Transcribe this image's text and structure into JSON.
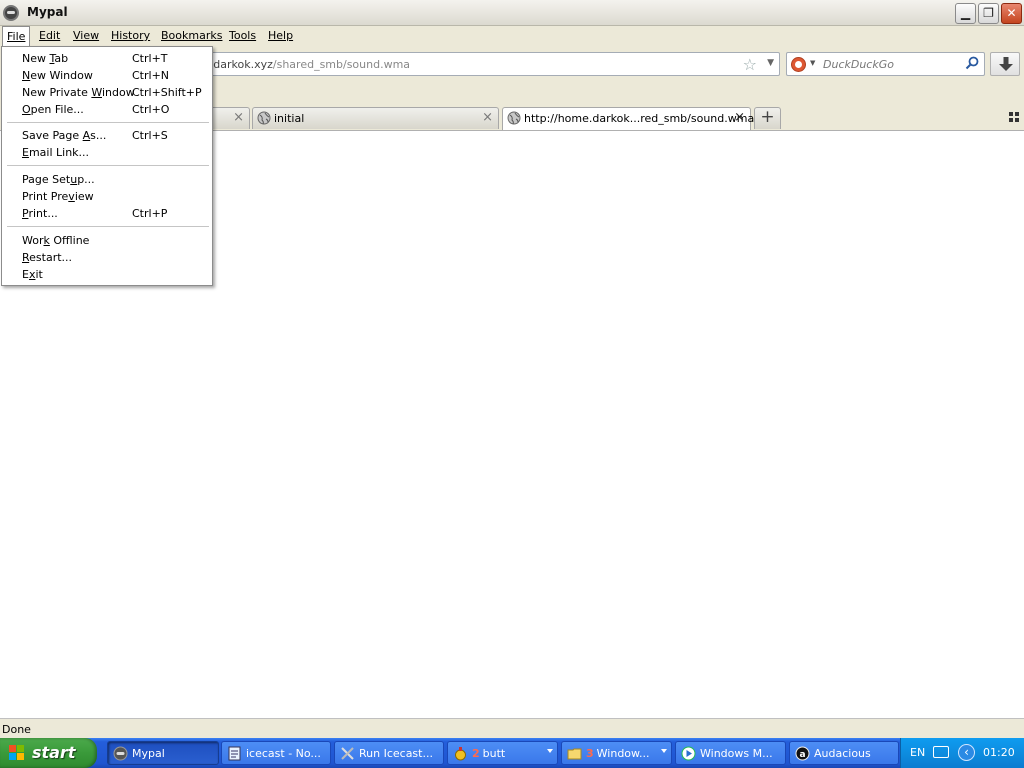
{
  "window": {
    "title": "Mypal"
  },
  "menubar": {
    "items": [
      "File",
      "Edit",
      "View",
      "History",
      "Bookmarks",
      "Tools",
      "Help"
    ]
  },
  "navbar": {
    "url_host": "e.darkok.xyz",
    "url_path": "/shared_smb/sound.wma",
    "search_placeholder": "DuckDuckGo"
  },
  "tabs": [
    {
      "label": ""
    },
    {
      "label": "initial"
    },
    {
      "label": "http://home.darkok...red_smb/sound.wma"
    }
  ],
  "status": {
    "text": "Done"
  },
  "file_menu": {
    "groups": [
      [
        {
          "pre": "New ",
          "ul": "T",
          "post": "ab",
          "shortcut": "Ctrl+T"
        },
        {
          "pre": "",
          "ul": "N",
          "post": "ew Window",
          "shortcut": "Ctrl+N"
        },
        {
          "pre": "New Private ",
          "ul": "W",
          "post": "indow",
          "shortcut": "Ctrl+Shift+P"
        },
        {
          "pre": "",
          "ul": "O",
          "post": "pen File...",
          "shortcut": "Ctrl+O"
        }
      ],
      [
        {
          "pre": "Save Page ",
          "ul": "A",
          "post": "s...",
          "shortcut": "Ctrl+S"
        },
        {
          "pre": "",
          "ul": "E",
          "post": "mail Link...",
          "shortcut": ""
        }
      ],
      [
        {
          "pre": "Page Set",
          "ul": "u",
          "post": "p...",
          "shortcut": ""
        },
        {
          "pre": "Print Pre",
          "ul": "v",
          "post": "iew",
          "shortcut": ""
        },
        {
          "pre": "",
          "ul": "P",
          "post": "rint...",
          "shortcut": "Ctrl+P"
        }
      ],
      [
        {
          "pre": "Wor",
          "ul": "k",
          "post": " Offline",
          "shortcut": ""
        },
        {
          "pre": "",
          "ul": "R",
          "post": "estart...",
          "shortcut": ""
        },
        {
          "pre": "E",
          "ul": "x",
          "post": "it",
          "shortcut": ""
        }
      ]
    ]
  },
  "taskbar": {
    "start_label": "start",
    "tasks": [
      {
        "label": "Mypal",
        "count": "",
        "icon": "mypal-icon",
        "active": true
      },
      {
        "label": "icecast - No...",
        "count": "",
        "icon": "notepad-icon",
        "active": false
      },
      {
        "label": "Run Icecast...",
        "count": "",
        "icon": "tools-icon",
        "active": false
      },
      {
        "label": "butt",
        "count": "2",
        "icon": "butt-icon",
        "active": false
      },
      {
        "label": "Window...",
        "count": "3",
        "icon": "folder-icon",
        "active": false
      },
      {
        "label": "Windows M...",
        "count": "",
        "icon": "media-player-icon",
        "active": false
      },
      {
        "label": "Audacious",
        "count": "",
        "icon": "audacious-icon",
        "active": false
      }
    ],
    "tray": {
      "language": "EN",
      "clock": "01:20"
    }
  },
  "colors": {
    "taskbar_blue": "#245edb",
    "start_green": "#3a9a3a",
    "close_red": "#c4451f",
    "chrome_beige": "#ece9d8"
  }
}
